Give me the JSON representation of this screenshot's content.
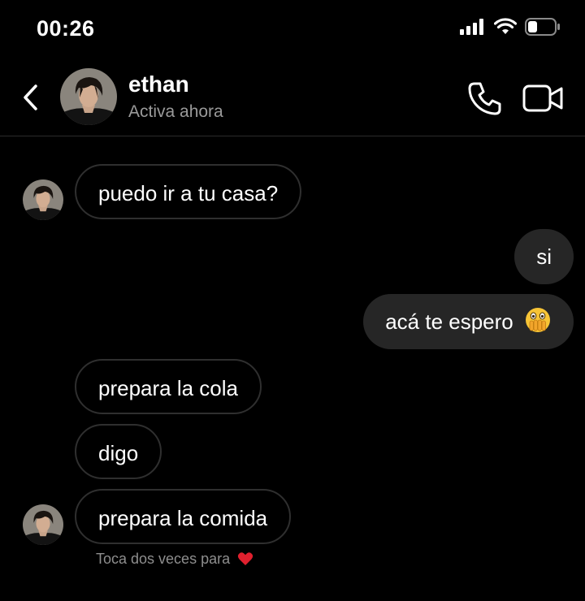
{
  "status_bar": {
    "time": "00:26"
  },
  "header": {
    "name": "ethan",
    "status": "Activa ahora"
  },
  "messages": [
    {
      "text": "puedo ir a tu casa?",
      "direction": "incoming"
    },
    {
      "text": "si",
      "direction": "outgoing"
    },
    {
      "text": "acá te espero",
      "direction": "outgoing",
      "emoji": "face-with-open-eyes-and-hand-over-mouth"
    },
    {
      "text": "prepara la cola",
      "direction": "incoming"
    },
    {
      "text": "digo",
      "direction": "incoming"
    },
    {
      "text": "prepara la comida",
      "direction": "incoming"
    }
  ],
  "hint": {
    "text": "Toca dos veces para",
    "icon": "heart-icon"
  },
  "colors": {
    "background": "#000000",
    "outgoing_bubble": "#262626",
    "incoming_border": "#2f2f2f",
    "secondary_text": "#9a9a9a",
    "heart": "#e0202e"
  }
}
